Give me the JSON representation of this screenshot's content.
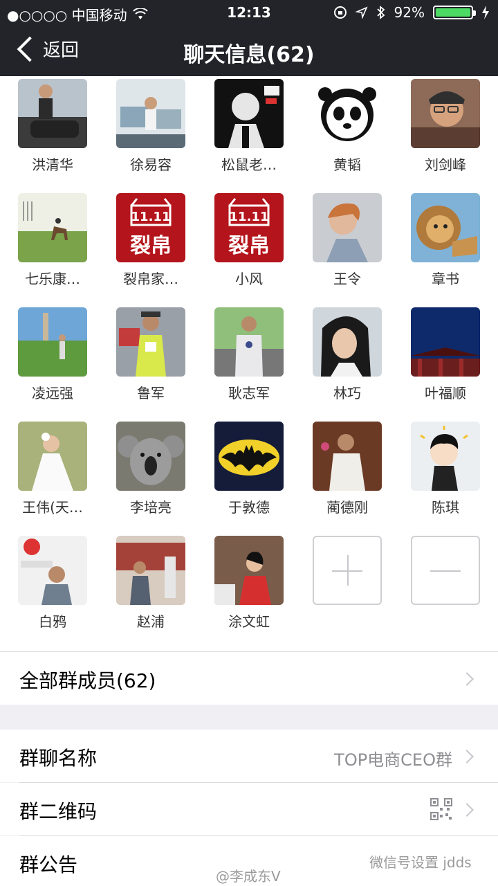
{
  "status": {
    "carrier": "●○○○○ 中国移动",
    "time": "12:13",
    "battery": "92%",
    "battery_level": 0.92
  },
  "nav": {
    "back_label": "返回",
    "title": "聊天信息(62)"
  },
  "members": [
    {
      "name": "洪清华"
    },
    {
      "name": "徐易容"
    },
    {
      "name": "松鼠老…"
    },
    {
      "name": "黄韬"
    },
    {
      "name": "刘剑峰"
    },
    {
      "name": "七乐康…"
    },
    {
      "name": "裂帛家…"
    },
    {
      "name": "小风"
    },
    {
      "name": "王令"
    },
    {
      "name": "章书"
    },
    {
      "name": "凌远强"
    },
    {
      "name": "鲁军"
    },
    {
      "name": "耿志军"
    },
    {
      "name": "林巧"
    },
    {
      "name": "叶福顺"
    },
    {
      "name": "王伟(天…"
    },
    {
      "name": "李培亮"
    },
    {
      "name": "于敦德"
    },
    {
      "name": "蔺德刚"
    },
    {
      "name": "陈琪"
    },
    {
      "name": "白鸦"
    },
    {
      "name": "赵浦"
    },
    {
      "name": "涂文虹"
    }
  ],
  "all_members": {
    "label": "全部群成员(62)"
  },
  "settings": {
    "group_name_label": "群聊名称",
    "group_name_value": "TOP电商CEO群",
    "qr_label": "群二维码",
    "notice_label": "群公告"
  },
  "watermarks": {
    "weibo": "@李成东V",
    "wechat": "微信号设置 jdds"
  }
}
